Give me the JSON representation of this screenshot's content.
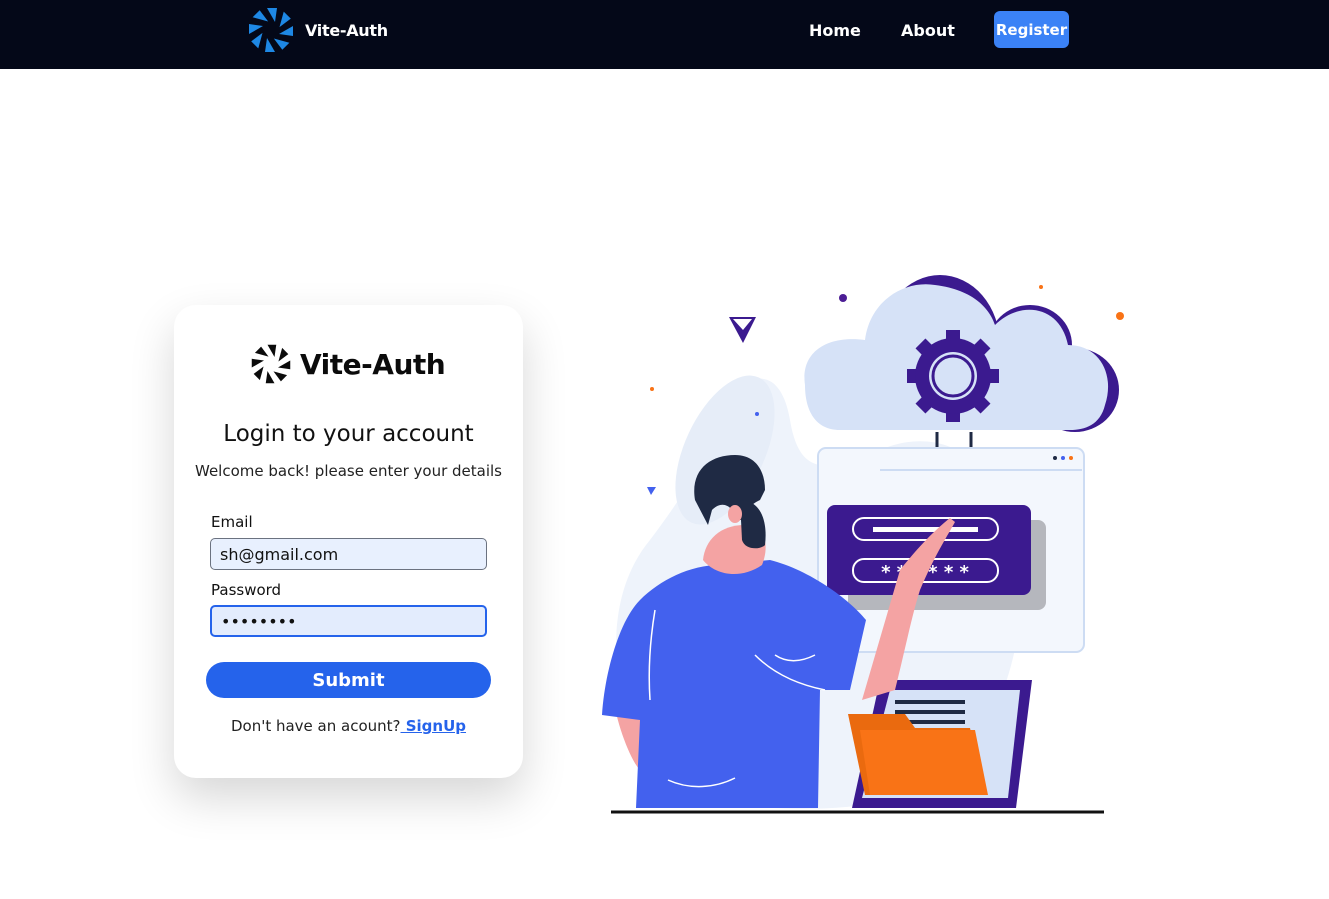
{
  "navbar": {
    "brand": "Vite-Auth",
    "links": [
      "Home",
      "About"
    ],
    "register_label": "Register"
  },
  "card": {
    "brand": "Vite-Auth",
    "title": "Login to your account",
    "subtitle": "Welcome back! please enter your details",
    "email_label": "Email",
    "email_value": "sh@gmail.com",
    "password_label": "Password",
    "password_value": "••••••••",
    "submit_label": "Submit",
    "signup_prompt": "Don't have an acount?",
    "signup_link": " SignUp",
    "password_card_mask": "* * * * * *"
  },
  "colors": {
    "navbar_bg": "#040818",
    "accent": "#2563eb",
    "register_bg": "#3b82f6",
    "logo_blue": "#1e88e5"
  },
  "icons": {
    "logo": "aperture-logo-icon"
  }
}
